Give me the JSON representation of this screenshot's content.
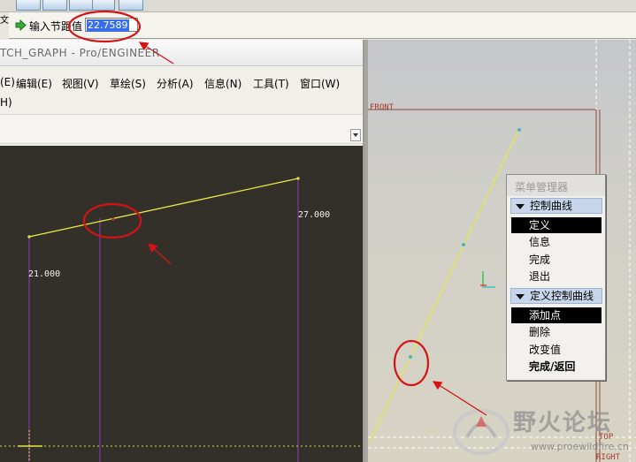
{
  "top_strip": {
    "left_char": "文"
  },
  "prompt": {
    "label": "输入节距值",
    "value": "22.7589"
  },
  "proe_window": {
    "title": "TCH_GRAPH - Pro/ENGINEER",
    "menu": [
      {
        "label": "(E)"
      },
      {
        "label": "编辑(E)"
      },
      {
        "label": "视图(V)"
      },
      {
        "label": "草绘(S)"
      },
      {
        "label": "分析(A)"
      },
      {
        "label": "信息(N)"
      },
      {
        "label": "工具(T)"
      },
      {
        "label": "窗口(W)"
      }
    ],
    "menu_overflow": "H)",
    "graph_labels": {
      "start_value": "21.000",
      "end_value": "27.000"
    }
  },
  "view_3d": {
    "datum_front": "FRONT",
    "datum_top": "TOP",
    "datum_right": "RIGHT"
  },
  "menu_manager": {
    "title": "菜单管理器",
    "section1": {
      "header": "控制曲线",
      "items": [
        "定义",
        "信息",
        "完成",
        "退出"
      ],
      "selected_index": 0
    },
    "section2": {
      "header": "定义控制曲线",
      "items": [
        "添加点",
        "删除",
        "改变值",
        "完成/返回"
      ],
      "selected_index": 0
    }
  },
  "watermark": {
    "site_name": "野火论坛",
    "url": "www.proewildfire.cn"
  },
  "colors": {
    "annotation_red": "#d41414",
    "curve_yellow": "#e8e84a",
    "sketch_bg": "#333029",
    "construction_purple": "#7c3aa8",
    "selection_blue": "#3a6ee8"
  }
}
